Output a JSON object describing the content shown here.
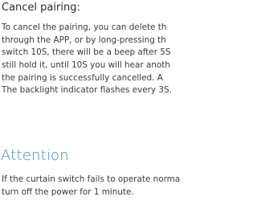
{
  "cancel_section": {
    "title": "Cancel pairing:",
    "lines": [
      "To cancel the pairing, you can delete th",
      "through the APP, or by long-pressing th",
      "switch 10S, there will be a beep after 5S",
      "still hold it, until 10S you will hear anoth",
      "the pairing is successfully cancelled. A",
      "The backlight indicator flashes every 3S."
    ]
  },
  "attention_section": {
    "heading": "Attention",
    "lines": [
      "If the curtain switch fails to operate norma",
      "turn off the power for 1 minute."
    ]
  },
  "colors": {
    "heading_accent": "#3b86c6",
    "text": "#3a3a3a"
  }
}
